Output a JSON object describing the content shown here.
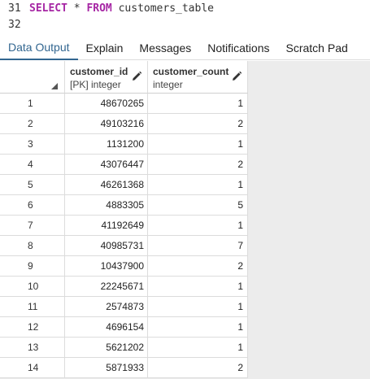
{
  "editor": {
    "lines": [
      {
        "num": "31",
        "kw1": "SELECT",
        "op": " * ",
        "kw2": "FROM",
        "ident": " customers_table"
      },
      {
        "num": "32"
      }
    ]
  },
  "tabs": [
    {
      "label": "Data Output",
      "active": true
    },
    {
      "label": "Explain"
    },
    {
      "label": "Messages"
    },
    {
      "label": "Notifications"
    },
    {
      "label": "Scratch Pad"
    }
  ],
  "grid": {
    "columns": [
      {
        "name": "customer_id",
        "type": "[PK] integer"
      },
      {
        "name": "customer_count",
        "type": "integer"
      }
    ],
    "rows": [
      {
        "n": "1",
        "id": "48670265",
        "count": "1"
      },
      {
        "n": "2",
        "id": "49103216",
        "count": "2"
      },
      {
        "n": "3",
        "id": "1131200",
        "count": "1"
      },
      {
        "n": "4",
        "id": "43076447",
        "count": "2"
      },
      {
        "n": "5",
        "id": "46261368",
        "count": "1"
      },
      {
        "n": "6",
        "id": "4883305",
        "count": "5"
      },
      {
        "n": "7",
        "id": "41192649",
        "count": "1"
      },
      {
        "n": "8",
        "id": "40985731",
        "count": "7"
      },
      {
        "n": "9",
        "id": "10437900",
        "count": "2"
      },
      {
        "n": "10",
        "id": "22245671",
        "count": "1"
      },
      {
        "n": "11",
        "id": "2574873",
        "count": "1"
      },
      {
        "n": "12",
        "id": "4696154",
        "count": "1"
      },
      {
        "n": "13",
        "id": "5621202",
        "count": "1"
      },
      {
        "n": "14",
        "id": "5871933",
        "count": "2"
      }
    ]
  }
}
